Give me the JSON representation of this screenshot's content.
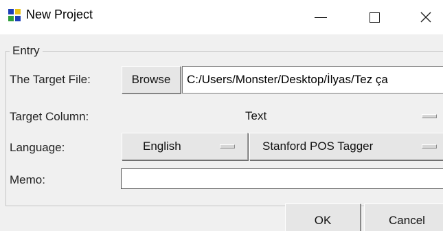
{
  "window": {
    "title": "New Project",
    "controls": [
      "minimize",
      "maximize",
      "close"
    ]
  },
  "entry": {
    "group_label": "Entry",
    "target_file": {
      "label": "The Target File:",
      "browse_label": "Browse",
      "value": "C:/Users/Monster/Desktop/İlyas/Tez ça"
    },
    "target_column": {
      "label": "Target Column:",
      "selected": "Text"
    },
    "language": {
      "label": "Language:",
      "selected": "English",
      "tagger_selected": "Stanford POS Tagger"
    },
    "memo": {
      "label": "Memo:",
      "value": ""
    }
  },
  "buttons": {
    "ok_label": "OK",
    "cancel_label": "Cancel"
  }
}
